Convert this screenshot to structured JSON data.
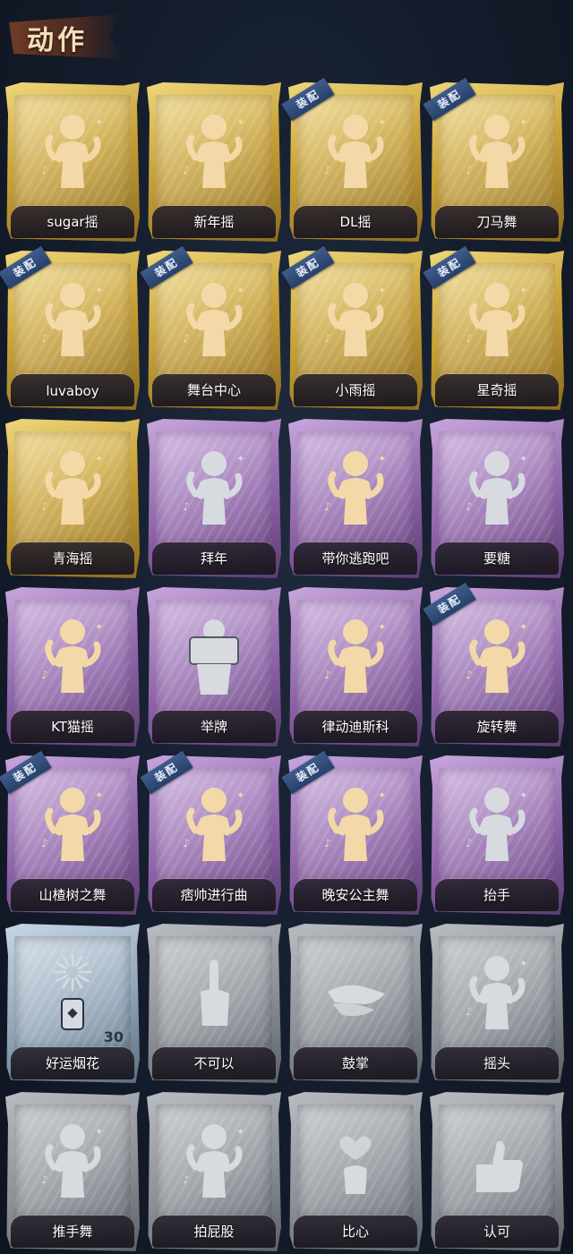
{
  "header": {
    "title": "动作"
  },
  "equip_badge_label": "装配",
  "cards": [
    {
      "name": "sugar摇",
      "rarity": "gold",
      "equipped": false,
      "icon": "dancer-shake-icon"
    },
    {
      "name": "新年摇",
      "rarity": "gold",
      "equipped": false,
      "icon": "dancer-clap-icon"
    },
    {
      "name": "DL摇",
      "rarity": "gold",
      "equipped": true,
      "icon": "dancer-point-up-icon"
    },
    {
      "name": "刀马舞",
      "rarity": "gold",
      "equipped": true,
      "icon": "dancer-fist-icon"
    },
    {
      "name": "luvaboy",
      "rarity": "gold",
      "equipped": true,
      "icon": "dancer-cross-arms-icon"
    },
    {
      "name": "舞台中心",
      "rarity": "gold",
      "equipped": true,
      "icon": "dancer-center-icon"
    },
    {
      "name": "小雨摇",
      "rarity": "gold",
      "equipped": true,
      "icon": "dancer-wave-icon"
    },
    {
      "name": "星奇摇",
      "rarity": "gold",
      "equipped": true,
      "icon": "dancer-sparkle-icon"
    },
    {
      "name": "青海摇",
      "rarity": "gold",
      "equipped": false,
      "icon": "dancer-shake-icon"
    },
    {
      "name": "拜年",
      "rarity": "purple",
      "equipped": false,
      "icon": "bow-greeting-icon"
    },
    {
      "name": "带你逃跑吧",
      "rarity": "purple",
      "equipped": false,
      "icon": "dancer-reach-icon"
    },
    {
      "name": "要糖",
      "rarity": "purple",
      "equipped": false,
      "icon": "candy-beg-icon"
    },
    {
      "name": "KT猫摇",
      "rarity": "purple",
      "equipped": false,
      "icon": "dancer-sway-icon"
    },
    {
      "name": "举牌",
      "rarity": "purple",
      "equipped": false,
      "icon": "hold-sign-icon"
    },
    {
      "name": "律动迪斯科",
      "rarity": "purple",
      "equipped": false,
      "icon": "dancer-disco-icon"
    },
    {
      "name": "旋转舞",
      "rarity": "purple",
      "equipped": true,
      "icon": "dancer-spin-icon"
    },
    {
      "name": "山楂树之舞",
      "rarity": "purple",
      "equipped": true,
      "icon": "dancer-arms-up-icon"
    },
    {
      "name": "痞帅进行曲",
      "rarity": "purple",
      "equipped": true,
      "icon": "dancer-flex-icon"
    },
    {
      "name": "晚安公主舞",
      "rarity": "purple",
      "equipped": true,
      "icon": "dancer-curtsy-icon"
    },
    {
      "name": "抬手",
      "rarity": "purple",
      "equipped": false,
      "icon": "raise-hand-icon"
    },
    {
      "name": "好运烟花",
      "rarity": "blue",
      "equipped": false,
      "icon": "firework-icon",
      "quantity": "30"
    },
    {
      "name": "不可以",
      "rarity": "gray",
      "equipped": false,
      "icon": "finger-wag-icon"
    },
    {
      "name": "鼓掌",
      "rarity": "gray",
      "equipped": false,
      "icon": "clap-hands-icon"
    },
    {
      "name": "摇头",
      "rarity": "gray",
      "equipped": false,
      "icon": "shake-head-icon"
    },
    {
      "name": "推手舞",
      "rarity": "gray",
      "equipped": false,
      "icon": "push-hands-icon"
    },
    {
      "name": "拍屁股",
      "rarity": "gray",
      "equipped": false,
      "icon": "pat-butt-icon"
    },
    {
      "name": "比心",
      "rarity": "gray",
      "equipped": false,
      "icon": "finger-heart-icon"
    },
    {
      "name": "认可",
      "rarity": "gray",
      "equipped": false,
      "icon": "thumbs-up-icon"
    }
  ],
  "colors": {
    "gold": "#d9b94a",
    "purple": "#9b74b8",
    "blue": "#a9bdd0",
    "gray": "#9a9ea4",
    "figure_lit": "#f3d9a8",
    "figure_dim": "#d7dbe0"
  }
}
